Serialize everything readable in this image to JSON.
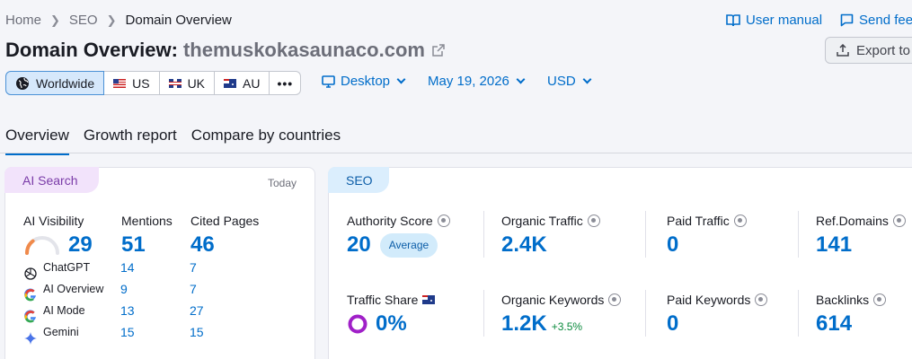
{
  "breadcrumb": [
    "Home",
    "SEO",
    "Domain Overview"
  ],
  "header": {
    "title_prefix": "Domain Overview:",
    "domain": "themuskokasaunaco.com",
    "user_manual": "User manual",
    "send_feedback": "Send feed",
    "export": "Export to"
  },
  "regions": [
    {
      "label": "Worldwide",
      "icon": "globe-icon",
      "active": true
    },
    {
      "label": "US",
      "icon": "flag-us"
    },
    {
      "label": "UK",
      "icon": "flag-uk"
    },
    {
      "label": "AU",
      "icon": "flag-au"
    },
    {
      "label": "•••"
    }
  ],
  "filters": {
    "device": "Desktop",
    "date": "May 19, 2026",
    "currency": "USD"
  },
  "tabs": [
    "Overview",
    "Growth report",
    "Compare by countries"
  ],
  "ai_card": {
    "pill": "AI Search",
    "today": "Today",
    "ai_visibility_label": "AI Visibility",
    "ai_visibility": "29",
    "ai_visibility_fraction": 0.29,
    "mentions_label": "Mentions",
    "mentions": "51",
    "cited_label": "Cited Pages",
    "cited": "46",
    "rows": [
      {
        "name": "ChatGPT",
        "mentions": "14",
        "cited": "7",
        "icon": "chatgpt-icon"
      },
      {
        "name": "AI Overview",
        "mentions": "9",
        "cited": "7",
        "icon": "google-icon"
      },
      {
        "name": "AI Mode",
        "mentions": "13",
        "cited": "27",
        "icon": "google-icon"
      },
      {
        "name": "Gemini",
        "mentions": "15",
        "cited": "15",
        "icon": "gemini-icon"
      }
    ]
  },
  "seo_card": {
    "pill": "SEO",
    "authority_label": "Authority Score",
    "authority": "20",
    "authority_badge": "Average",
    "organic_traffic_label": "Organic Traffic",
    "organic_traffic": "2.4K",
    "paid_traffic_label": "Paid Traffic",
    "paid_traffic": "0",
    "ref_domains_label": "Ref.Domains",
    "ref_domains": "141",
    "traffic_share_label": "Traffic Share",
    "traffic_share": "0%",
    "organic_keywords_label": "Organic Keywords",
    "organic_keywords": "1.2K",
    "organic_keywords_change": "+3.5%",
    "paid_keywords_label": "Paid Keywords",
    "paid_keywords": "0",
    "backlinks_label": "Backlinks",
    "backlinks": "614"
  },
  "colors": {
    "accent": "#006dca",
    "ai_pill": "#f2e3fb",
    "seo_pill": "#dbeefd",
    "growth": "#0a8a3c",
    "gauge": "#f08a4b",
    "ring": "#a020c8"
  }
}
